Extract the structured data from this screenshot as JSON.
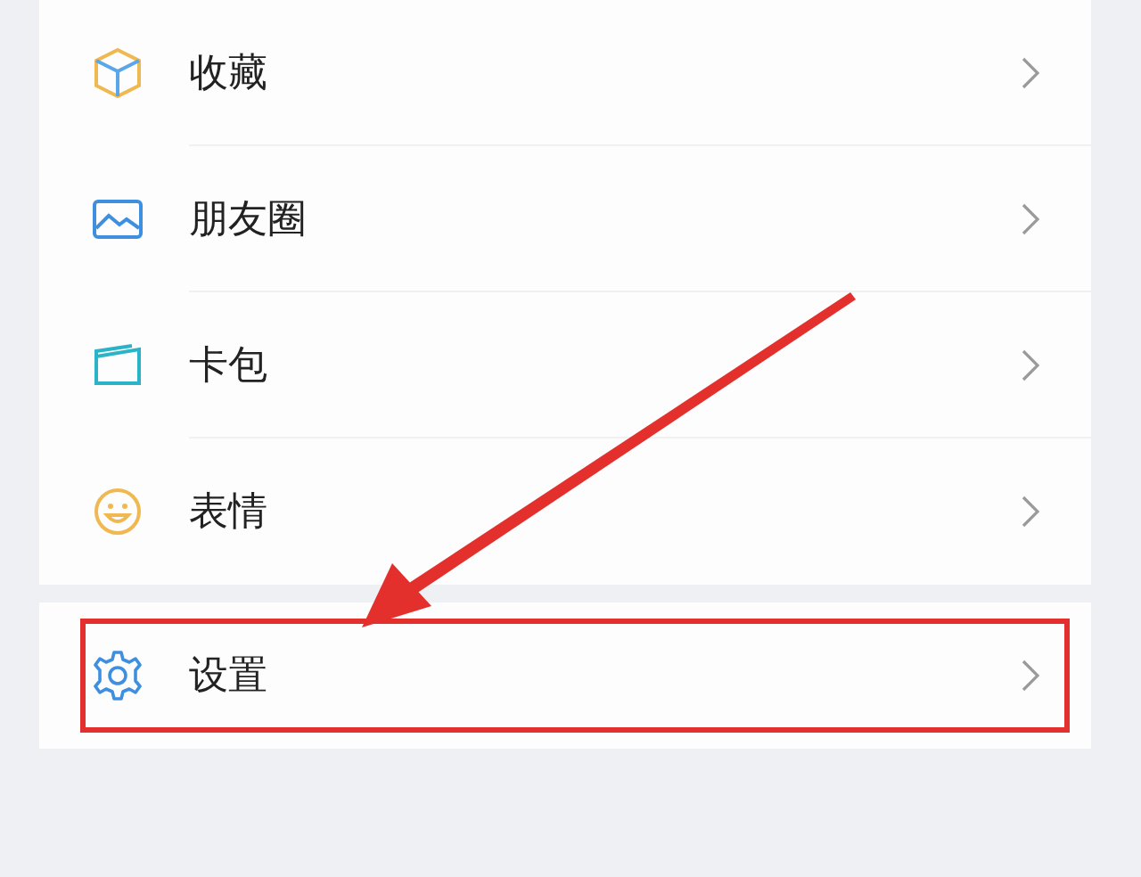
{
  "menu_items": [
    {
      "label": "收藏"
    },
    {
      "label": "朋友圈"
    },
    {
      "label": "卡包"
    },
    {
      "label": "表情"
    }
  ],
  "settings_item": {
    "label": "设置"
  }
}
